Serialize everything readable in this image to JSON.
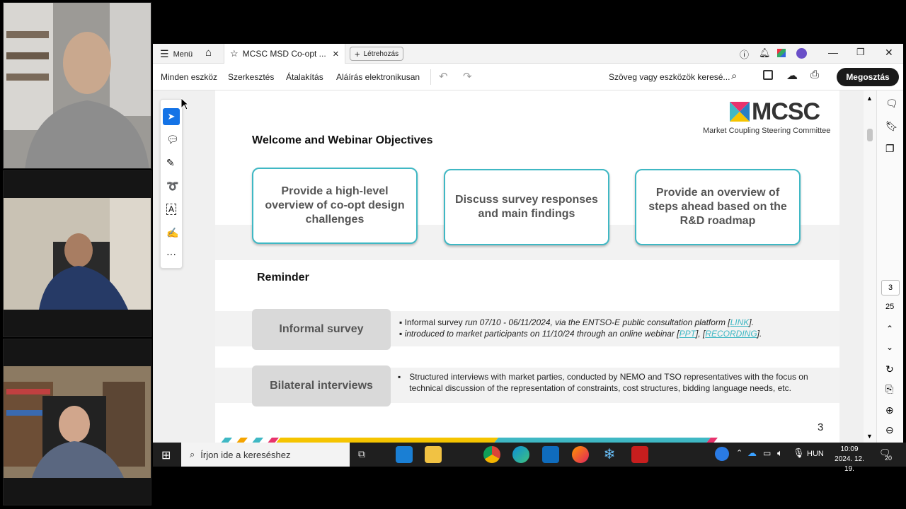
{
  "window": {
    "menu_label": "Menü",
    "tab_title": "MCSC MSD Co-opt ...",
    "create_label": "Létrehozás"
  },
  "toolbar": {
    "items": [
      "Minden eszköz",
      "Szerkesztés",
      "Átalakítás",
      "Aláírás elektronikusan"
    ],
    "search_placeholder": "Szöveg vagy eszközök keresé...",
    "share_label": "Megosztás"
  },
  "page_nav": {
    "current": "3",
    "total": "25"
  },
  "slide": {
    "logo_text": "MCSC",
    "logo_subtitle": "Market Coupling Steering Committee",
    "title": "Welcome and Webinar Objectives",
    "objectives": [
      "Provide a high-level overview of co-opt design challenges",
      "Discuss survey responses and main findings",
      "Provide an overview of steps ahead based on the R&D roadmap"
    ],
    "reminder_title": "Reminder",
    "informal": {
      "label": "Informal survey",
      "line1_a": "Informal survey ",
      "line1_b": "run 07/10 - 06/11/2024, via the ENTSO-E public consultation platform [",
      "line1_link": "LINK",
      "line1_c": "].",
      "line2_a": "introduced to market participants on 11/10/24 through an online webinar [",
      "line2_link1": "PPT",
      "line2_mid": "], [",
      "line2_link2": "RECORDING",
      "line2_c": "]."
    },
    "bilateral": {
      "label": "Bilateral interviews",
      "text": "Structured interviews with market parties, conducted by NEMO and TSO representatives with the focus on technical discussion of the representation of constraints, cost structures, bidding language needs, etc."
    },
    "page_number": "3"
  },
  "taskbar": {
    "search_placeholder": "Írjon ide a kereséshez",
    "language": "HUN",
    "time": "10:09",
    "date": "2024. 12. 19.",
    "notifications": "20"
  },
  "colors": {
    "accent": "#3fb8c4",
    "share_button": "#1a1a1a",
    "select_tool": "#1473e6"
  }
}
